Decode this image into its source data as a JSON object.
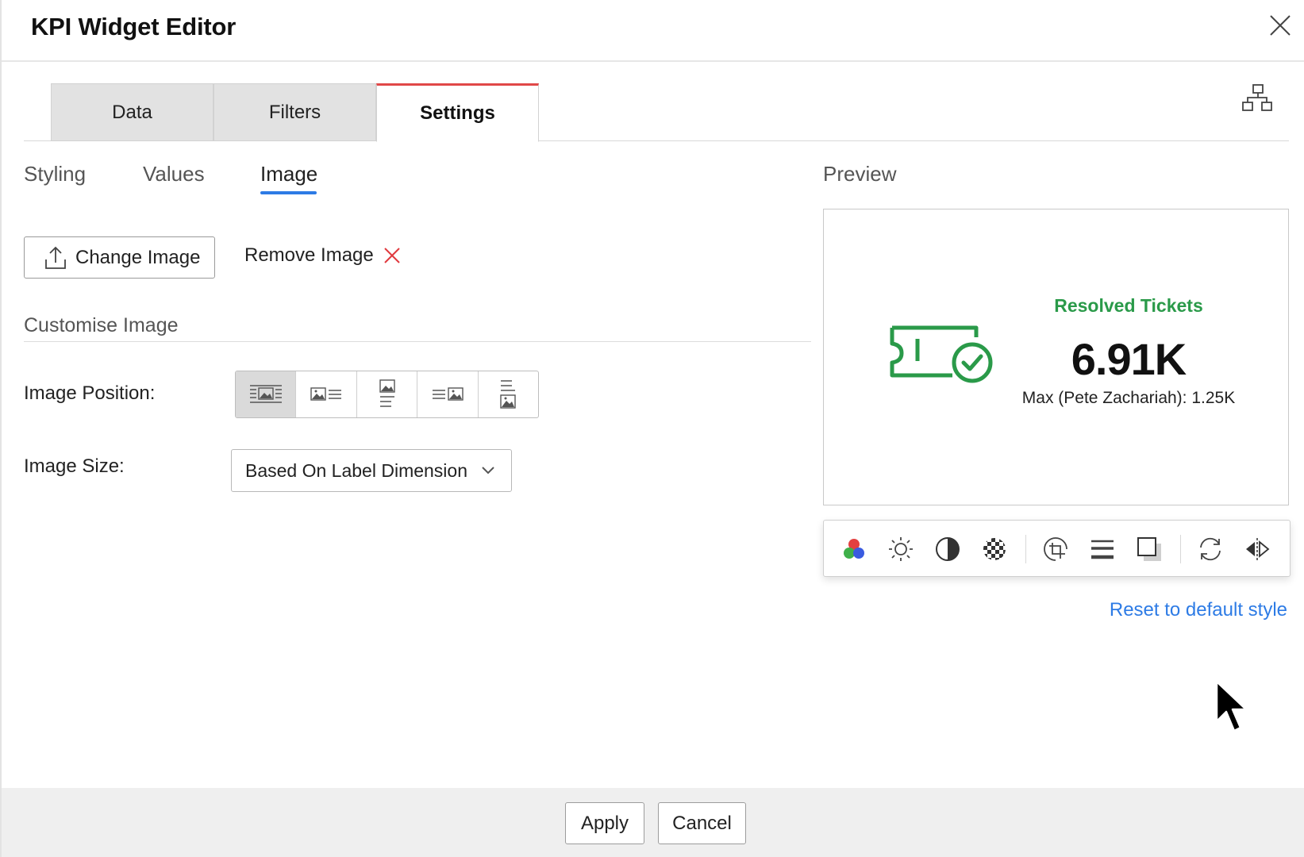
{
  "dialog": {
    "title": "KPI Widget Editor",
    "close_icon": "close-icon"
  },
  "main_tabs": [
    {
      "label": "Data",
      "active": false
    },
    {
      "label": "Filters",
      "active": false
    },
    {
      "label": "Settings",
      "active": true
    }
  ],
  "sub_tabs": [
    {
      "label": "Styling",
      "active": false
    },
    {
      "label": "Values",
      "active": false
    },
    {
      "label": "Image",
      "active": true
    }
  ],
  "image_actions": {
    "change_label": "Change Image",
    "remove_label": "Remove Image"
  },
  "customise": {
    "section_title": "Customise Image",
    "position_label": "Image Position:",
    "position_options": [
      "image-center-text-icon",
      "image-left-icon",
      "image-top-icon",
      "image-right-icon",
      "image-bottom-icon"
    ],
    "position_selected_index": 0,
    "size_label": "Image Size:",
    "size_value": "Based On Label Dimension"
  },
  "preview": {
    "label": "Preview",
    "kpi_label": "Resolved Tickets",
    "kpi_value": "6.91K",
    "kpi_sub": "Max (Pete Zachariah): 1.25K",
    "accent_color": "#2a9a49"
  },
  "toolbar_icons": [
    "color-overlay-icon",
    "brightness-icon",
    "contrast-icon",
    "transparency-icon",
    "crop-icon",
    "border-icon",
    "shadow-icon",
    "rotate-icon",
    "flip-icon"
  ],
  "reset_label": "Reset to default style",
  "footer": {
    "apply_label": "Apply",
    "cancel_label": "Cancel"
  }
}
